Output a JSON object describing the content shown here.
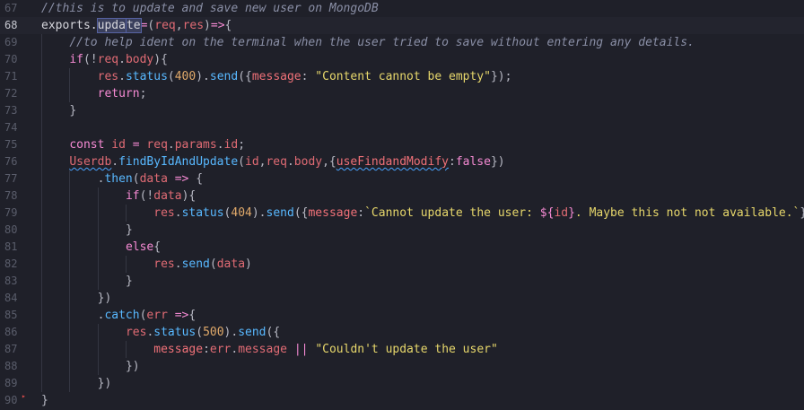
{
  "editor": {
    "lines": [
      {
        "num": "67",
        "tokens": [
          {
            "c": "c-comment",
            "t": "//this is to update and save new user on MongoDB"
          }
        ]
      },
      {
        "num": "68",
        "current": true,
        "tokens": [
          {
            "c": "c-plain",
            "t": "exports."
          },
          {
            "c": "c-plain sel",
            "t": "upda"
          },
          {
            "cursor": true
          },
          {
            "c": "c-plain sel",
            "t": "te"
          },
          {
            "c": "c-op",
            "t": "="
          },
          {
            "c": "c-punct",
            "t": "("
          },
          {
            "c": "c-ident",
            "t": "req"
          },
          {
            "c": "c-punct",
            "t": ","
          },
          {
            "c": "c-ident",
            "t": "res"
          },
          {
            "c": "c-punct",
            "t": ")"
          },
          {
            "c": "c-op",
            "t": "=>"
          },
          {
            "c": "c-punct",
            "t": "{"
          }
        ]
      },
      {
        "num": "69",
        "indent": 1,
        "tokens": [
          {
            "c": "c-comment",
            "t": "//to help ident on the terminal when the user tried to save without entering any details."
          }
        ]
      },
      {
        "num": "70",
        "indent": 1,
        "tokens": [
          {
            "c": "c-kw",
            "t": "if"
          },
          {
            "c": "c-punct",
            "t": "(!"
          },
          {
            "c": "c-ident",
            "t": "req"
          },
          {
            "c": "c-punct",
            "t": "."
          },
          {
            "c": "c-ident",
            "t": "body"
          },
          {
            "c": "c-punct",
            "t": "){"
          }
        ]
      },
      {
        "num": "71",
        "indent": 2,
        "tokens": [
          {
            "c": "c-ident",
            "t": "res"
          },
          {
            "c": "c-punct",
            "t": "."
          },
          {
            "c": "c-fn",
            "t": "status"
          },
          {
            "c": "c-punct",
            "t": "("
          },
          {
            "c": "c-num",
            "t": "400"
          },
          {
            "c": "c-punct",
            "t": ")."
          },
          {
            "c": "c-fn",
            "t": "send"
          },
          {
            "c": "c-punct",
            "t": "({"
          },
          {
            "c": "c-prop",
            "t": "message"
          },
          {
            "c": "c-punct",
            "t": ": "
          },
          {
            "c": "c-str",
            "t": "\"Content cannot be empty\""
          },
          {
            "c": "c-punct",
            "t": "});"
          }
        ]
      },
      {
        "num": "72",
        "indent": 2,
        "tokens": [
          {
            "c": "c-kw",
            "t": "return"
          },
          {
            "c": "c-punct",
            "t": ";"
          }
        ]
      },
      {
        "num": "73",
        "indent": 1,
        "tokens": [
          {
            "c": "c-punct",
            "t": "}"
          }
        ]
      },
      {
        "num": "74",
        "indent": 1,
        "tokens": []
      },
      {
        "num": "75",
        "indent": 1,
        "tokens": [
          {
            "c": "c-kw",
            "t": "const"
          },
          {
            "c": "c-plain",
            "t": " "
          },
          {
            "c": "c-ident",
            "t": "id"
          },
          {
            "c": "c-plain",
            "t": " "
          },
          {
            "c": "c-op",
            "t": "="
          },
          {
            "c": "c-plain",
            "t": " "
          },
          {
            "c": "c-ident",
            "t": "req"
          },
          {
            "c": "c-punct",
            "t": "."
          },
          {
            "c": "c-ident",
            "t": "params"
          },
          {
            "c": "c-punct",
            "t": "."
          },
          {
            "c": "c-ident",
            "t": "id"
          },
          {
            "c": "c-punct",
            "t": ";"
          }
        ]
      },
      {
        "num": "76",
        "indent": 1,
        "tokens": [
          {
            "c": "c-ident squiggle",
            "t": "Userdb"
          },
          {
            "c": "c-punct",
            "t": "."
          },
          {
            "c": "c-fn",
            "t": "findByIdAndUpdate"
          },
          {
            "c": "c-punct",
            "t": "("
          },
          {
            "c": "c-ident",
            "t": "id"
          },
          {
            "c": "c-punct",
            "t": ","
          },
          {
            "c": "c-ident",
            "t": "req"
          },
          {
            "c": "c-punct",
            "t": "."
          },
          {
            "c": "c-ident",
            "t": "body"
          },
          {
            "c": "c-punct",
            "t": ",{"
          },
          {
            "c": "c-prop squiggle",
            "t": "useFindandModify"
          },
          {
            "c": "c-punct",
            "t": ":"
          },
          {
            "c": "c-kw",
            "t": "false"
          },
          {
            "c": "c-punct",
            "t": "})"
          }
        ]
      },
      {
        "num": "77",
        "indent": 2,
        "tokens": [
          {
            "c": "c-punct",
            "t": "."
          },
          {
            "c": "c-fn",
            "t": "then"
          },
          {
            "c": "c-punct",
            "t": "("
          },
          {
            "c": "c-ident",
            "t": "data"
          },
          {
            "c": "c-plain",
            "t": " "
          },
          {
            "c": "c-op",
            "t": "=>"
          },
          {
            "c": "c-plain",
            "t": " "
          },
          {
            "c": "c-punct",
            "t": "{"
          }
        ]
      },
      {
        "num": "78",
        "indent": 3,
        "tokens": [
          {
            "c": "c-kw",
            "t": "if"
          },
          {
            "c": "c-punct",
            "t": "(!"
          },
          {
            "c": "c-ident",
            "t": "data"
          },
          {
            "c": "c-punct",
            "t": "){"
          }
        ]
      },
      {
        "num": "79",
        "indent": 4,
        "tokens": [
          {
            "c": "c-ident",
            "t": "res"
          },
          {
            "c": "c-punct",
            "t": "."
          },
          {
            "c": "c-fn",
            "t": "status"
          },
          {
            "c": "c-punct",
            "t": "("
          },
          {
            "c": "c-num",
            "t": "404"
          },
          {
            "c": "c-punct",
            "t": ")."
          },
          {
            "c": "c-fn",
            "t": "send"
          },
          {
            "c": "c-punct",
            "t": "({"
          },
          {
            "c": "c-prop",
            "t": "message"
          },
          {
            "c": "c-punct",
            "t": ":"
          },
          {
            "c": "c-str",
            "t": "`Cannot update the user: "
          },
          {
            "c": "c-kw",
            "t": "${"
          },
          {
            "c": "c-ident",
            "t": "id"
          },
          {
            "c": "c-kw",
            "t": "}"
          },
          {
            "c": "c-str",
            "t": ". Maybe this not not available.`"
          },
          {
            "c": "c-punct",
            "t": "})"
          }
        ]
      },
      {
        "num": "80",
        "indent": 3,
        "tokens": [
          {
            "c": "c-punct",
            "t": "}"
          }
        ]
      },
      {
        "num": "81",
        "indent": 3,
        "tokens": [
          {
            "c": "c-kw",
            "t": "else"
          },
          {
            "c": "c-punct",
            "t": "{"
          }
        ]
      },
      {
        "num": "82",
        "indent": 4,
        "tokens": [
          {
            "c": "c-ident",
            "t": "res"
          },
          {
            "c": "c-punct",
            "t": "."
          },
          {
            "c": "c-fn",
            "t": "send"
          },
          {
            "c": "c-punct",
            "t": "("
          },
          {
            "c": "c-ident",
            "t": "data"
          },
          {
            "c": "c-punct",
            "t": ")"
          }
        ]
      },
      {
        "num": "83",
        "indent": 3,
        "tokens": [
          {
            "c": "c-punct",
            "t": "}"
          }
        ]
      },
      {
        "num": "84",
        "indent": 2,
        "tokens": [
          {
            "c": "c-punct",
            "t": "})"
          }
        ]
      },
      {
        "num": "85",
        "indent": 2,
        "tokens": [
          {
            "c": "c-punct",
            "t": "."
          },
          {
            "c": "c-fn",
            "t": "catch"
          },
          {
            "c": "c-punct",
            "t": "("
          },
          {
            "c": "c-ident",
            "t": "err"
          },
          {
            "c": "c-plain",
            "t": " "
          },
          {
            "c": "c-op",
            "t": "=>"
          },
          {
            "c": "c-punct",
            "t": "{"
          }
        ]
      },
      {
        "num": "86",
        "indent": 3,
        "tokens": [
          {
            "c": "c-ident",
            "t": "res"
          },
          {
            "c": "c-punct",
            "t": "."
          },
          {
            "c": "c-fn",
            "t": "status"
          },
          {
            "c": "c-punct",
            "t": "("
          },
          {
            "c": "c-num",
            "t": "500"
          },
          {
            "c": "c-punct",
            "t": ")."
          },
          {
            "c": "c-fn",
            "t": "send"
          },
          {
            "c": "c-punct",
            "t": "({"
          }
        ]
      },
      {
        "num": "87",
        "indent": 4,
        "tokens": [
          {
            "c": "c-prop",
            "t": "message"
          },
          {
            "c": "c-punct",
            "t": ":"
          },
          {
            "c": "c-ident",
            "t": "err"
          },
          {
            "c": "c-punct",
            "t": "."
          },
          {
            "c": "c-ident",
            "t": "message"
          },
          {
            "c": "c-plain",
            "t": " "
          },
          {
            "c": "c-op",
            "t": "||"
          },
          {
            "c": "c-plain",
            "t": " "
          },
          {
            "c": "c-str",
            "t": "\"Couldn't update the user\""
          }
        ]
      },
      {
        "num": "88",
        "indent": 3,
        "tokens": [
          {
            "c": "c-punct",
            "t": "})"
          }
        ]
      },
      {
        "num": "89",
        "indent": 2,
        "tokens": [
          {
            "c": "c-punct",
            "t": "})"
          }
        ]
      },
      {
        "num": "90",
        "tokens": [
          {
            "c": "c-punct",
            "t": "}"
          }
        ]
      }
    ]
  },
  "colors": {
    "background": "#1f2029",
    "comment": "#8a8fa6",
    "keyword": "#f58ad3",
    "function": "#58b8ff",
    "identifier": "#e06b74",
    "string": "#e7d76b",
    "number": "#e0a96a"
  }
}
